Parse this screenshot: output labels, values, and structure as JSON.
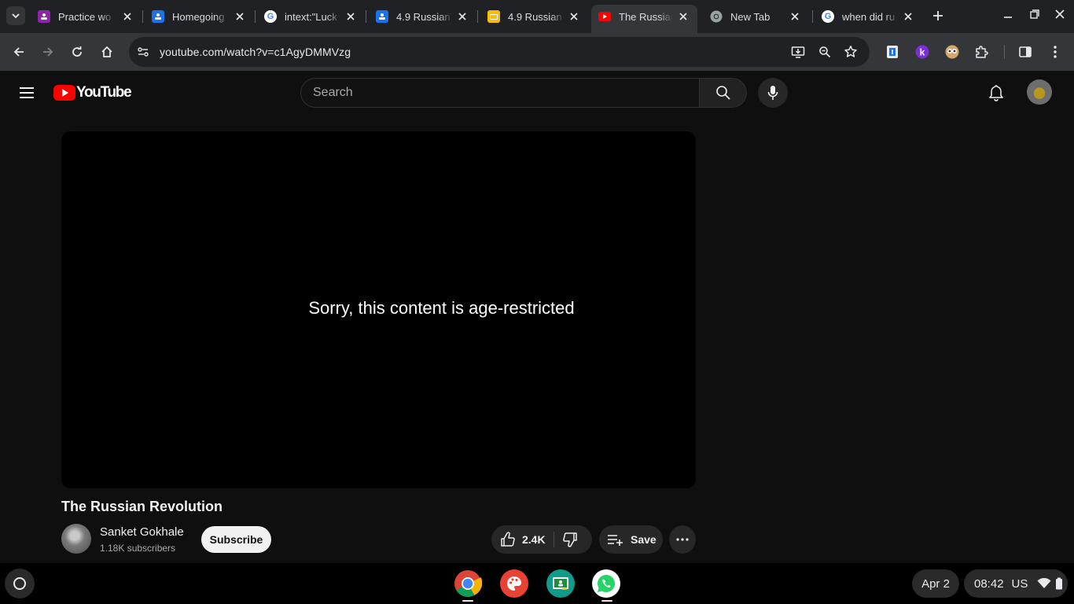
{
  "browser": {
    "tabs": [
      {
        "title": "Practice wo",
        "favicon": "classroom-icon",
        "color": "#8e24aa"
      },
      {
        "title": "Homegoing",
        "favicon": "classroom-icon",
        "color": "#1a73e8"
      },
      {
        "title": "intext:\"Luck",
        "favicon": "google-icon",
        "color": "#ffffff"
      },
      {
        "title": "4.9 Russian",
        "favicon": "classroom-icon",
        "color": "#1a73e8"
      },
      {
        "title": "4.9 Russian",
        "favicon": "slides-icon",
        "color": "#fbbc04"
      },
      {
        "title": "The Russian",
        "favicon": "youtube-icon",
        "color": "#ff0000",
        "active": true
      },
      {
        "title": "New Tab",
        "favicon": "chrome-icon",
        "color": "#9aa0a6"
      },
      {
        "title": "when did ru",
        "favicon": "google-icon",
        "color": "#ffffff"
      }
    ],
    "url": "youtube.com/watch?v=c1AgyDMMVzg"
  },
  "youtube": {
    "logo_text": "YouTube",
    "search_placeholder": "Search",
    "player_message": "Sorry, this content is age-restricted",
    "video_title": "The Russian Revolution",
    "channel_name": "Sanket Gokhale",
    "channel_subscribers": "1.18K subscribers",
    "subscribe_label": "Subscribe",
    "like_count": "2.4K",
    "save_label": "Save"
  },
  "shelf": {
    "apps": [
      "chrome-icon",
      "canvas-icon",
      "classroom-icon",
      "whatsapp-icon"
    ],
    "date": "Apr 2",
    "time": "08:42",
    "ime": "US"
  },
  "colors": {
    "yt_red": "#ff0000",
    "background": "#0f0f0f",
    "chrome_toolbar": "#35363a"
  }
}
